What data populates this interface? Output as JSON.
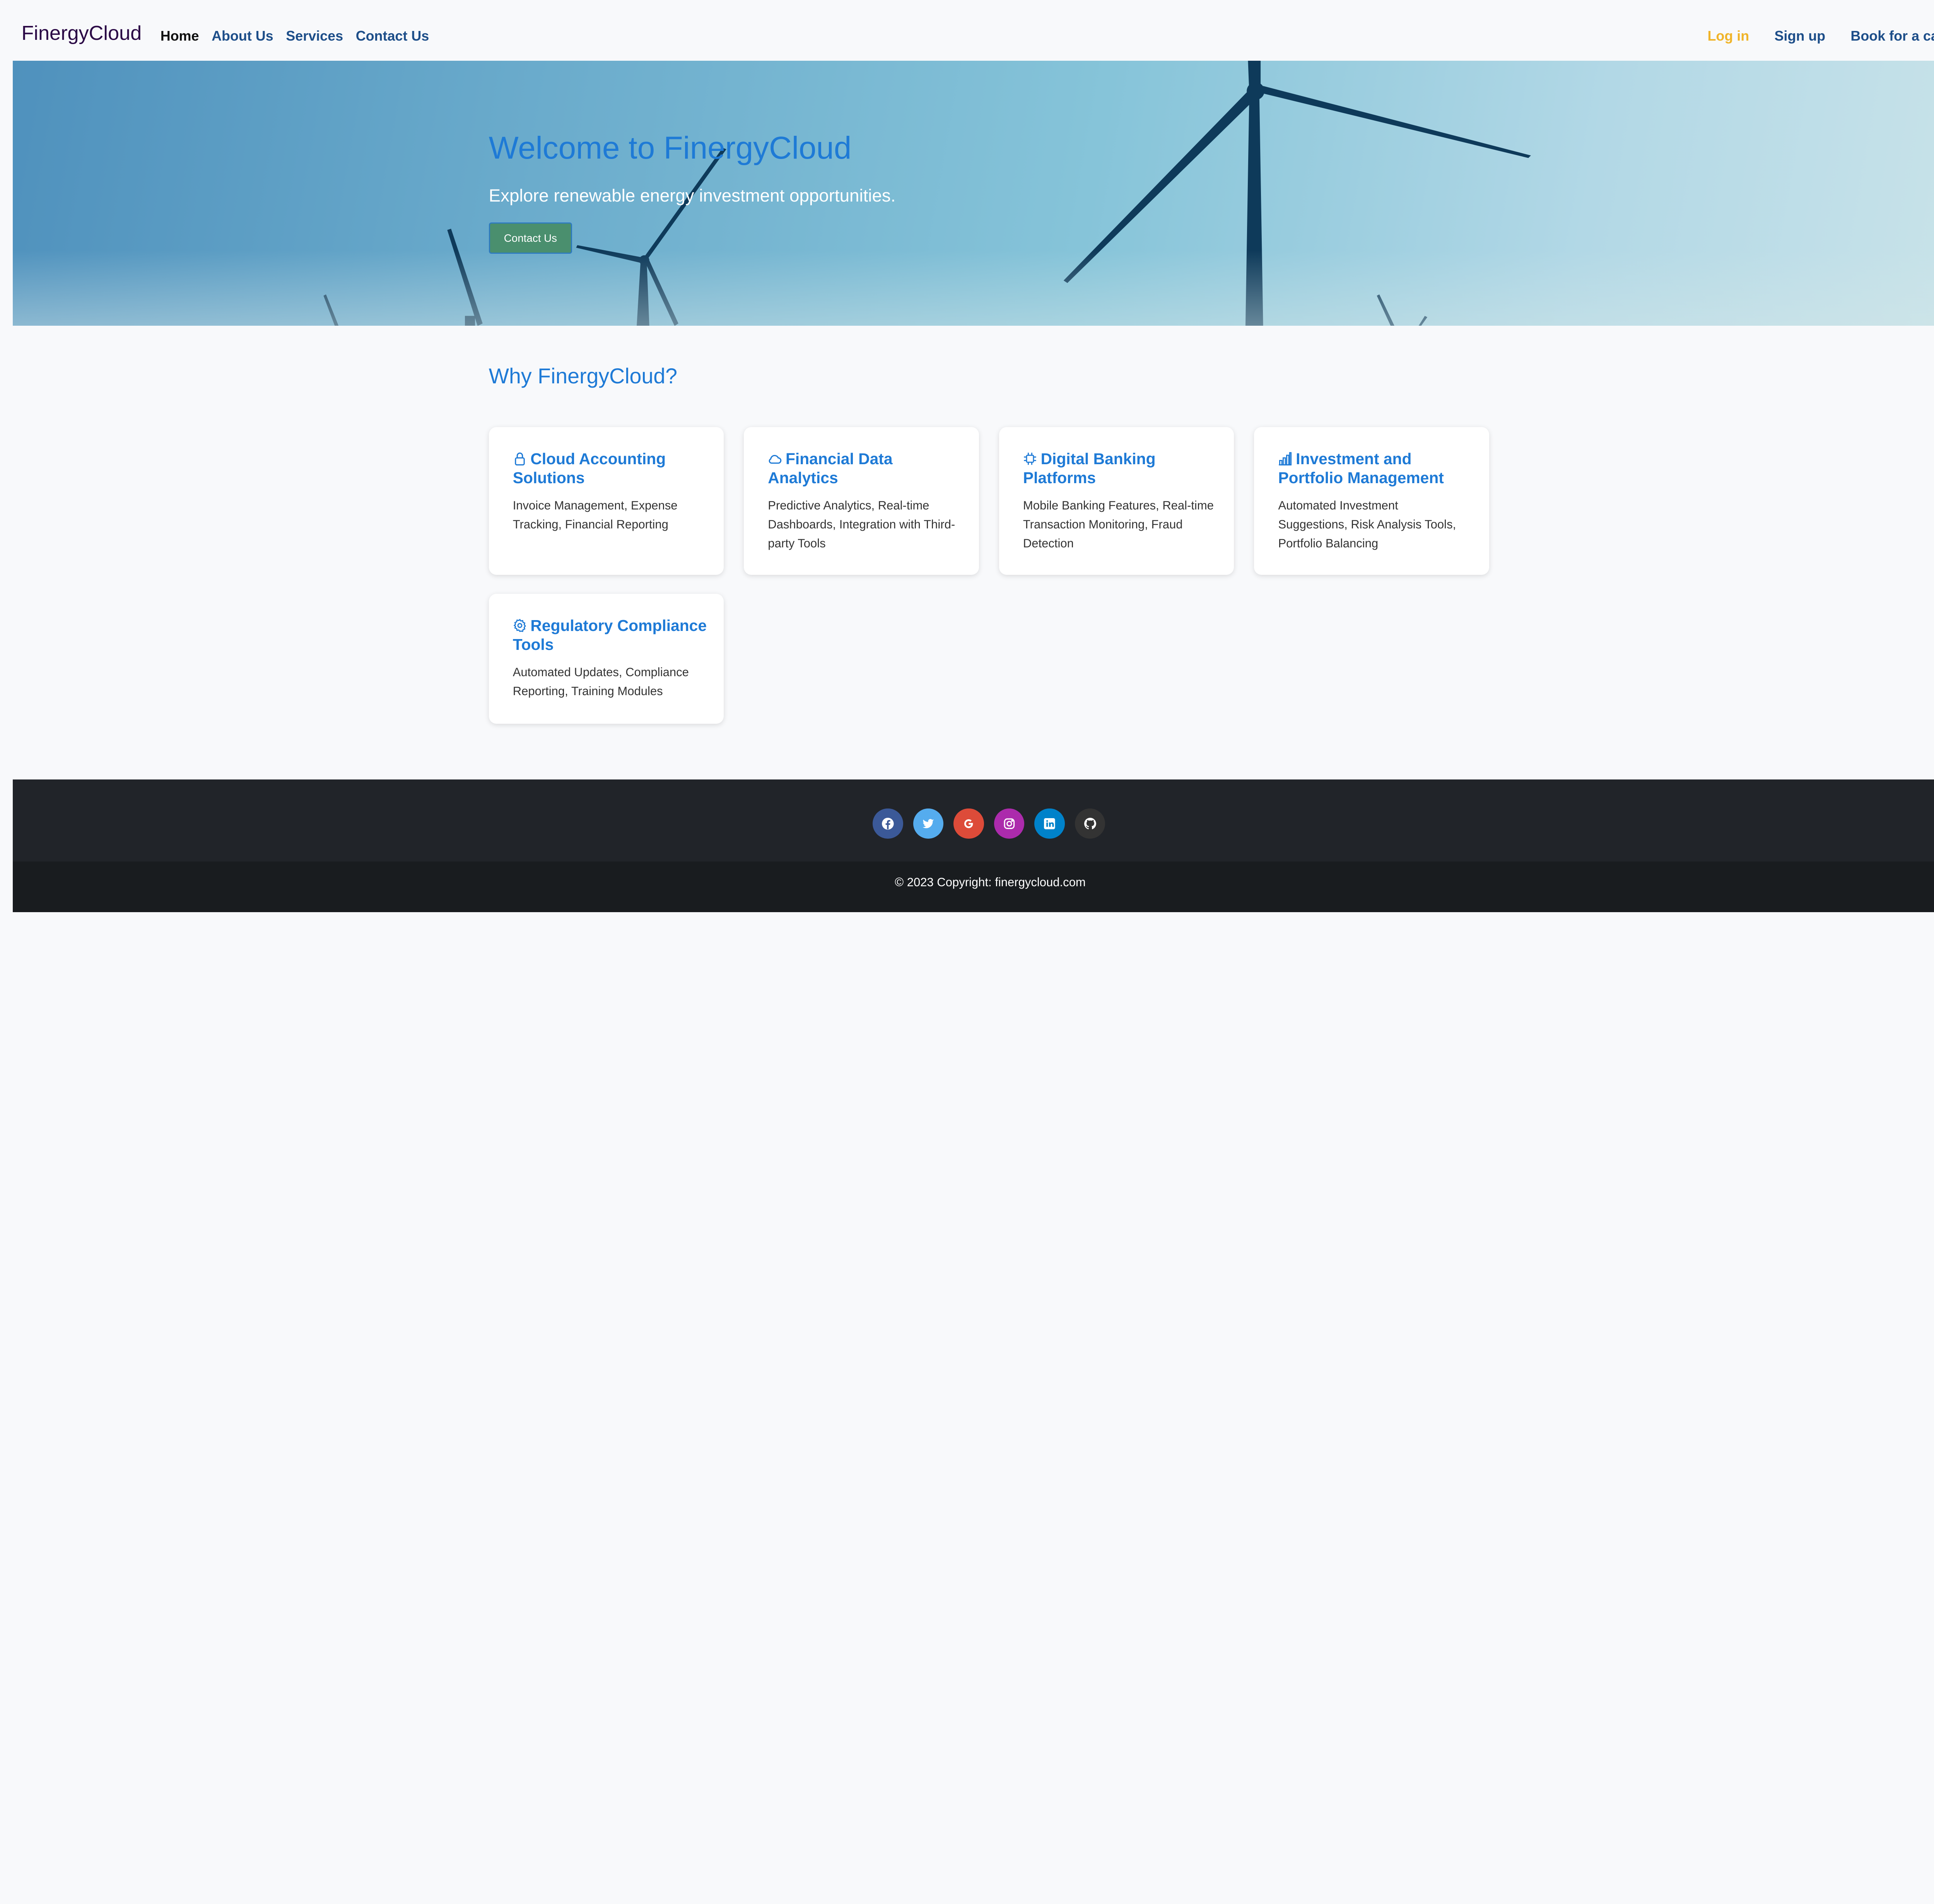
{
  "navbar": {
    "brand": "FinergyCloud",
    "links": [
      "Home",
      "About Us",
      "Services",
      "Contact Us"
    ],
    "login": "Log in",
    "signup": "Sign up",
    "book_call": "Book for a call"
  },
  "hero": {
    "title": "Welcome to FinergyCloud",
    "subtitle": "Explore renewable energy investment opportunities.",
    "button": "Contact Us"
  },
  "why": {
    "title": "Why FinergyCloud?",
    "cards": [
      {
        "icon": "lock-icon",
        "title": "Cloud Accounting Solutions",
        "desc": "Invoice Management, Expense Tracking, Financial Reporting"
      },
      {
        "icon": "cloud-icon",
        "title": "Financial Data Analytics",
        "desc": "Predictive Analytics, Real-time Dashboards, Integration with Third-party Tools"
      },
      {
        "icon": "cpu-icon",
        "title": "Digital Banking Platforms",
        "desc": "Mobile Banking Features, Real-time Transaction Monitoring, Fraud Detection"
      },
      {
        "icon": "bar-chart-icon",
        "title": "Investment and Portfolio Management",
        "desc": "Automated Investment Suggestions, Risk Analysis Tools, Portfolio Balancing"
      },
      {
        "icon": "gear-icon",
        "title": "Regulatory Compliance Tools",
        "desc": "Automated Updates, Compliance Reporting, Training Modules"
      }
    ]
  },
  "footer": {
    "socials": [
      {
        "icon": "facebook-icon",
        "color": "#3b5998"
      },
      {
        "icon": "twitter-icon",
        "color": "#55acee"
      },
      {
        "icon": "google-icon",
        "color": "#dd4b39"
      },
      {
        "icon": "instagram-icon",
        "color": "#ac2bac"
      },
      {
        "icon": "linkedin-icon",
        "color": "#0082ca"
      },
      {
        "icon": "github-icon",
        "color": "#333333"
      }
    ],
    "copyright": "© 2023 Copyright: finergycloud.com"
  },
  "colors": {
    "accent": "#1e7ad6",
    "brand": "#2a0845",
    "login": "#f0b429",
    "footer_dark": "#212429"
  }
}
